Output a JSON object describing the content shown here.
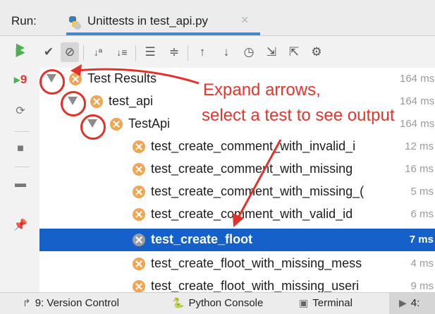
{
  "header": {
    "run_label": "Run:",
    "tab_title": "Unittests in test_api.py",
    "tab_close": "×"
  },
  "toolbar": {
    "buttons": [
      {
        "name": "rerun-icon",
        "glyph": "▶"
      },
      {
        "name": "show-passed-icon",
        "glyph": "✔"
      },
      {
        "name": "show-ignored-icon",
        "glyph": "⊘"
      },
      {
        "name": "sort-alpha-icon",
        "glyph": "↓ª"
      },
      {
        "name": "sort-duration-icon",
        "glyph": "↓≡"
      },
      {
        "name": "expand-all-icon",
        "glyph": "⇊"
      },
      {
        "name": "collapse-all-icon",
        "glyph": "⇈"
      },
      {
        "name": "prev-failed-icon",
        "glyph": "↑"
      },
      {
        "name": "next-failed-icon",
        "glyph": "↓"
      },
      {
        "name": "history-icon",
        "glyph": "⏱"
      },
      {
        "name": "import-tests-icon",
        "glyph": "⇲"
      },
      {
        "name": "export-tests-icon",
        "glyph": "⇱"
      },
      {
        "name": "settings-icon",
        "glyph": "⚙"
      }
    ]
  },
  "left_strip": {
    "rerun_failed_count": "9",
    "icons": [
      "rerun-failed-icon",
      "toggle-auto-test-icon",
      "stop-icon",
      "layout-icon",
      "pin-icon"
    ]
  },
  "tree": {
    "rows": [
      {
        "label": "Test Results",
        "duration": "164 ms",
        "indent": 1,
        "arrow": true
      },
      {
        "label": "test_api",
        "duration": "164 ms",
        "indent": 2,
        "arrow": true
      },
      {
        "label": "TestApi",
        "duration": "164 ms",
        "indent": 3,
        "arrow": true
      },
      {
        "label": "test_create_comment_with_invalid_i",
        "duration": "12 ms",
        "indent": 4,
        "arrow": false
      },
      {
        "label": "test_create_comment_with_missing",
        "duration": "16 ms",
        "indent": 4,
        "arrow": false
      },
      {
        "label": "test_create_comment_with_missing_(",
        "duration": "5 ms",
        "indent": 4,
        "arrow": false
      },
      {
        "label": "test_create_comment_with_valid_id",
        "duration": "6 ms",
        "indent": 4,
        "arrow": false
      },
      {
        "label": "test_create_floot",
        "duration": "7 ms",
        "indent": 4,
        "arrow": false,
        "selected": true
      },
      {
        "label": "test_create_floot_with_missing_mess",
        "duration": "4 ms",
        "indent": 4,
        "arrow": false
      },
      {
        "label": "test_create_floot_with_missing_useri",
        "duration": "9 ms",
        "indent": 4,
        "arrow": false
      }
    ]
  },
  "annotation": {
    "line1": "Expand arrows,",
    "line2": "select a test to see output",
    "color": "#e3322b"
  },
  "bottom_bar": {
    "version_control": "9: Version Control",
    "python_console": "Python Console",
    "terminal": "Terminal",
    "run_tab": "4:"
  }
}
